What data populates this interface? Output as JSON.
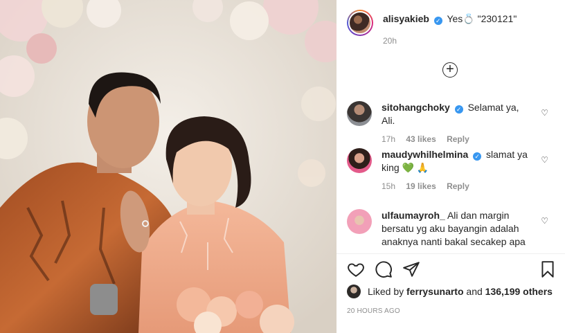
{
  "post": {
    "username": "alisyakieb",
    "caption_prefix": "Yes",
    "caption_ring": "💍",
    "caption_text": "\"230121\"",
    "time": "20h"
  },
  "comments": [
    {
      "username": "sitohangchoky",
      "text": "Selamat ya, Ali.",
      "time": "17h",
      "likes": "43 likes",
      "reply": "Reply"
    },
    {
      "username": "maudywhilhelmina",
      "text": "slamat ya king",
      "emoji": "💚 🙏",
      "time": "15h",
      "likes": "19 likes",
      "reply": "Reply"
    },
    {
      "username": "ulfaumayroh_",
      "text": "Ali dan margin bersatu yg aku bayangin adalah anaknya nanti bakal secakep apa"
    }
  ],
  "likes": {
    "prefix": "Liked by",
    "user": "ferrysunarto",
    "and": "and",
    "count": "136,199 others"
  },
  "timestamp": "20 HOURS AGO",
  "icons": [
    "verified-badge",
    "add-circle-icon",
    "heart-icon",
    "comment-icon",
    "share-icon",
    "bookmark-icon"
  ],
  "colors": {
    "verified": "#3897f0",
    "muted": "#8e8e8e",
    "text": "#262626"
  }
}
